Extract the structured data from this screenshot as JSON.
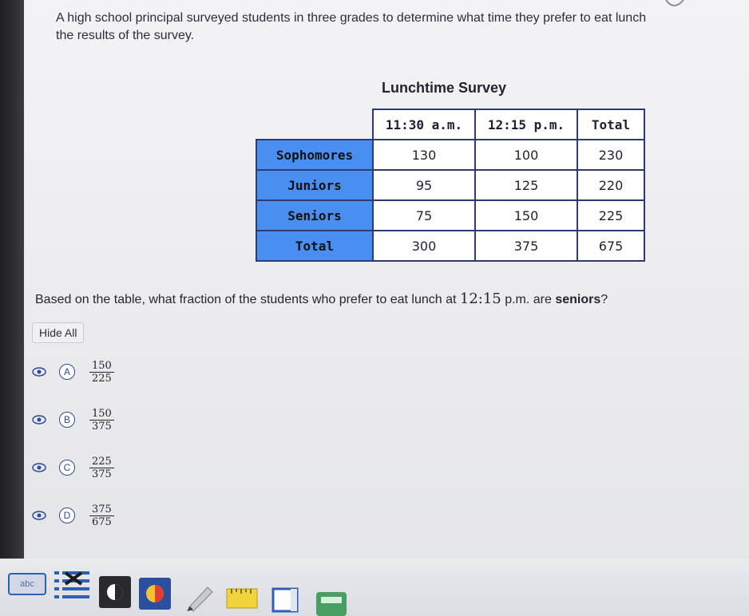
{
  "intro": {
    "line1": "A high school principal surveyed students in three grades to determine what time they prefer to eat lunch",
    "line2": "the results of the survey."
  },
  "table": {
    "title": "Lunchtime Survey",
    "columns": [
      "11:30 a.m.",
      "12:15 p.m.",
      "Total"
    ],
    "rows": [
      {
        "label": "Sophomores",
        "values": [
          "130",
          "100",
          "230"
        ]
      },
      {
        "label": "Juniors",
        "values": [
          "95",
          "125",
          "220"
        ]
      },
      {
        "label": "Seniors",
        "values": [
          "75",
          "150",
          "225"
        ]
      },
      {
        "label": "Total",
        "values": [
          "300",
          "375",
          "675"
        ]
      }
    ]
  },
  "question": {
    "before": "Based on the table, what fraction of the students who prefer to eat lunch at ",
    "time": "12:15",
    "middle": " p.m. are ",
    "strong": "seniors",
    "after": "?"
  },
  "hide_all_label": "Hide All",
  "choices": [
    {
      "letter": "A",
      "num": "150",
      "den": "225"
    },
    {
      "letter": "B",
      "num": "150",
      "den": "375"
    },
    {
      "letter": "C",
      "num": "225",
      "den": "375"
    },
    {
      "letter": "D",
      "num": "375",
      "den": "675"
    }
  ],
  "toolbar": {
    "abc_label": "abc"
  },
  "colors": {
    "row_header": "#4a8ef0",
    "border": "#2e3b73",
    "accent": "#2c4b9e"
  }
}
